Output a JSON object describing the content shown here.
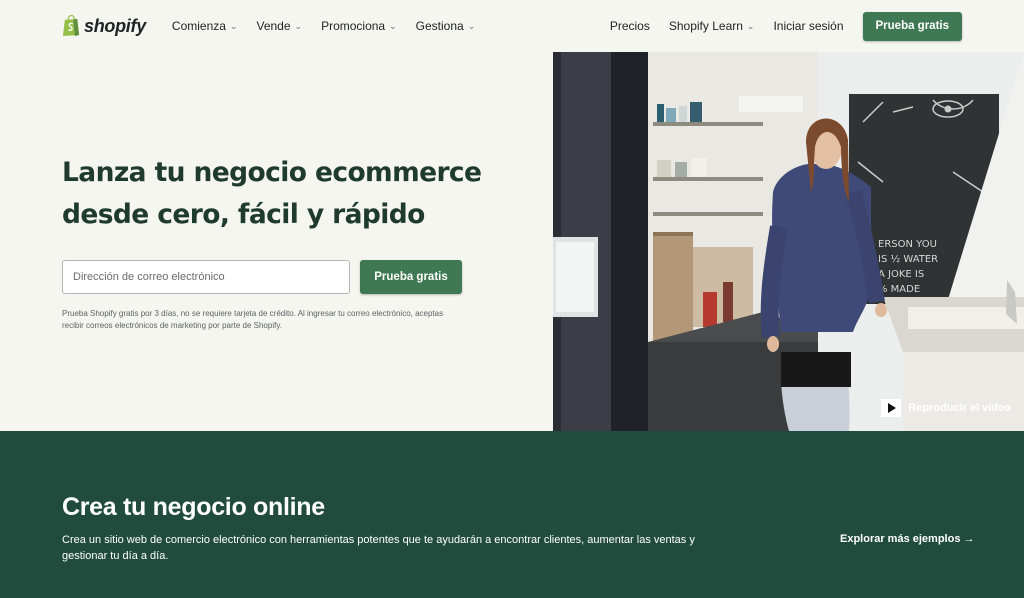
{
  "header": {
    "logo_text": "shopify",
    "nav": [
      {
        "label": "Comienza"
      },
      {
        "label": "Vende"
      },
      {
        "label": "Promociona"
      },
      {
        "label": "Gestiona"
      }
    ],
    "right_links": {
      "pricing": "Precios",
      "learn": "Shopify Learn",
      "login": "Iniciar sesión"
    },
    "cta": "Prueba gratis"
  },
  "hero": {
    "title_line1": "Lanza tu negocio ecommerce",
    "title_line2": "desde cero, fácil y rápido",
    "email_placeholder": "Dirección de correo electrónico",
    "email_value": "",
    "cta": "Prueba gratis",
    "disclaimer": "Prueba Shopify gratis por 3 días, no se requiere tarjeta de crédito. Al ingresar tu correo electrónico, aceptas recibir correos electrónicos de marketing por parte de Shopify.",
    "video_label": "Reproducir el video"
  },
  "section": {
    "title": "Crea tu negocio online",
    "description": "Crea un sitio web de comercio electrónico con herramientas potentes que te ayudarán a encontrar clientes, aumentar las ventas y gestionar tu día a día.",
    "explore_link": "Explorar más ejemplos →"
  },
  "colors": {
    "page_bg": "#f6f6f0",
    "brand_green": "#3f7953",
    "dark_green": "#214c3d",
    "heading_green": "#1f3a2e"
  },
  "icons": {
    "logo": "shopify-bag-icon",
    "dropdown": "chevron-down-icon",
    "play": "play-icon"
  }
}
